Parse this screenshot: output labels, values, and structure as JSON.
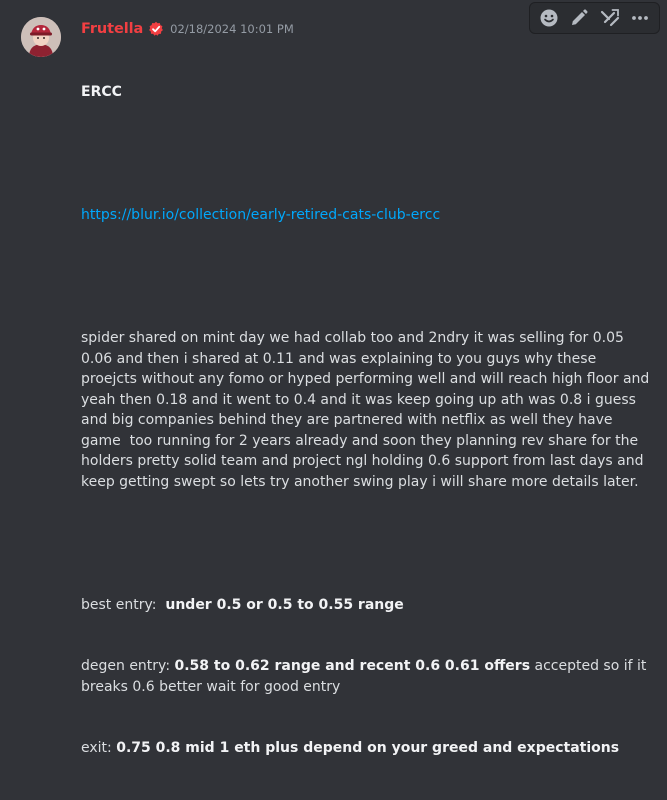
{
  "message": {
    "username": "Frutella",
    "timestamp": "02/18/2024 10:01 PM",
    "title": "ERCC",
    "link": "https://blur.io/collection/early-retired-cats-club-ercc",
    "paragraph": "spider shared on mint day we had collab too and 2ndry it was selling for 0.05 0.06 and then i shared at 0.11 and was explaining to you guys why these proejcts without any fomo or hyped performing well and will reach high floor and yeah then 0.18 and it went to 0.4 and it was keep going up ath was 0.8 i guess and big companies behind they are partnered with netflix as well they have game  too running for 2 years already and soon they planning rev share for the holders pretty solid team and project ngl holding 0.6 support from last days and keep getting swept so lets try another swing play i will share more details later.",
    "best_entry_label": "best entry:  ",
    "best_entry_value": "under 0.5 or 0.5 to 0.55 range",
    "degen_entry_label": "degen entry: ",
    "degen_entry_value": "0.58 to 0.62 range and recent 0.6 0.61 offers",
    "degen_entry_tail": " accepted so if it breaks 0.6 better wait for good entry",
    "exit_label": "exit: ",
    "exit_value": "0.75 0.8 mid 1 eth plus depend on your greed and expectations"
  },
  "toolbar": {
    "icons": [
      "emoji-icon",
      "edit-icon",
      "tools-icon",
      "more-icon"
    ]
  },
  "colors": {
    "background": "#313338",
    "username": "#f23f42",
    "link": "#00a8fc",
    "text": "#dbdee1",
    "timestamp": "#949ba4"
  }
}
